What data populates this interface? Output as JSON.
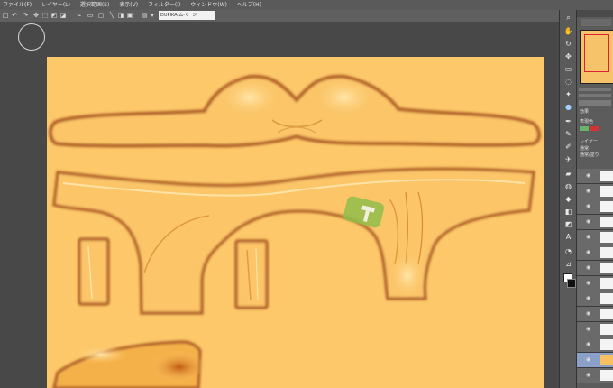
{
  "menu": {
    "items": [
      "ファイル(F)",
      "レイヤー(L)",
      "選択範囲(S)",
      "表示(V)",
      "フィルター(I)",
      "ウィンドウ(W)",
      "ヘルプ(H)"
    ]
  },
  "toolbar": {
    "field_value": "DUPIKA-ムページ"
  },
  "panel": {
    "effect_label": "効果",
    "expression_label": "表現色",
    "layer_label": "レイヤー",
    "layer_property_label": "通常/塗り",
    "blend_label": "通常"
  },
  "colors": {
    "canvas_bg": "#fcc869",
    "outline": "#b4632a",
    "highlight": "#ffe3a6",
    "shadow": "#d38b2a",
    "gizmo_green": "#8fbd4a",
    "accent_red": "#d33333"
  },
  "icons": {
    "tools": [
      "zoom-icon",
      "hand-icon",
      "rotate-icon",
      "move-icon",
      "select-icon",
      "lasso-icon",
      "wand-icon",
      "eyedropper-icon",
      "pen-icon",
      "pencil-icon",
      "brush-icon",
      "airbrush-icon",
      "decorate-icon",
      "eraser-icon",
      "fill-icon",
      "gradient-icon",
      "figure-icon",
      "text-icon",
      "balloon-icon",
      "ruler-icon",
      "blend-icon"
    ]
  }
}
